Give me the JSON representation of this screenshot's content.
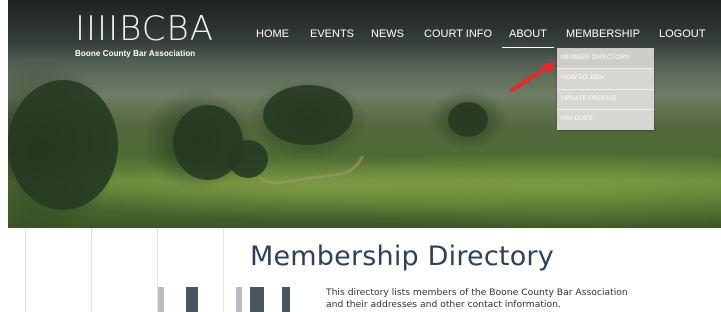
{
  "logo": {
    "mark": "IIIIBCBA",
    "name": "Boone County Bar Association"
  },
  "nav": {
    "items": [
      {
        "label": "HOME"
      },
      {
        "label": "EVENTS"
      },
      {
        "label": "NEWS"
      },
      {
        "label": "COURT INFO"
      },
      {
        "label": "ABOUT"
      },
      {
        "label": "MEMBERSHIP"
      },
      {
        "label": "LOGOUT"
      }
    ],
    "active": "ABOUT"
  },
  "membership_menu": {
    "items": [
      {
        "label": "MEMBER DIRECTORY"
      },
      {
        "label": "HOW TO JOIN"
      },
      {
        "label": "UPDATE PROFILE"
      },
      {
        "label": "PAY DUES"
      }
    ]
  },
  "annotation": {
    "arrow_color": "#e8272a",
    "icon": "red-arrow-icon"
  },
  "main": {
    "title": "Membership Directory",
    "description": "This directory lists members of the Boone County Bar Association and their addresses and other contact information."
  },
  "colors": {
    "title": "#2e4257",
    "dropdown_bg": "#d8d6d2"
  }
}
